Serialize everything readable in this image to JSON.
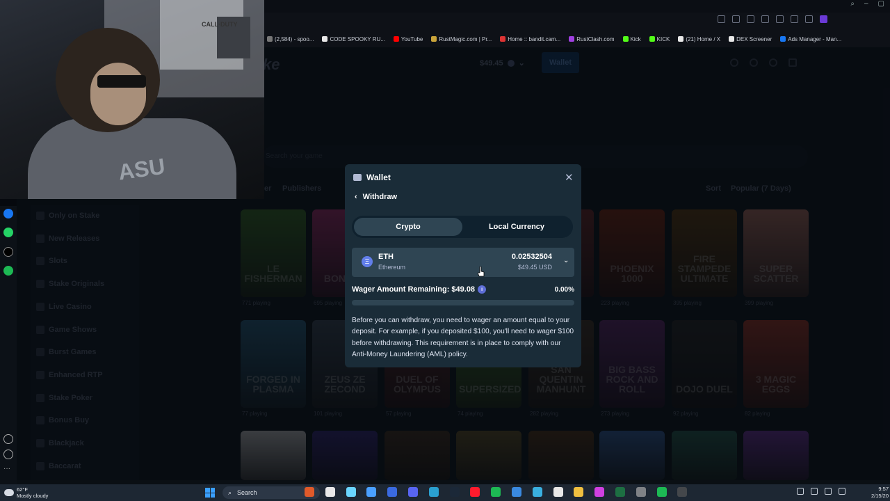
{
  "browser": {
    "bookmarks": [
      {
        "label": "(2,584) - spoo...",
        "color": "#777"
      },
      {
        "label": "CODE SPOOKY RU...",
        "color": "#e8e8e8"
      },
      {
        "label": "YouTube",
        "color": "#ff0000"
      },
      {
        "label": "RustMagic.com | Pr...",
        "color": "#c9a43a"
      },
      {
        "label": "Home :: bandit.cam...",
        "color": "#d33"
      },
      {
        "label": "RustClash.com",
        "color": "#a040e0"
      },
      {
        "label": "Kick",
        "color": "#53fc18"
      },
      {
        "label": "KICK",
        "color": "#53fc18"
      },
      {
        "label": "(21) Home / X",
        "color": "#e8e8e8"
      },
      {
        "label": "DEX Screener",
        "color": "#e8e8e8"
      },
      {
        "label": "Ads Manager - Man...",
        "color": "#1877f2"
      }
    ]
  },
  "webcam": {
    "shirt_text": "ASU",
    "poster_text": "CALL·DUTY"
  },
  "header": {
    "logo": "ke",
    "balance": "$49.45",
    "wallet_button": "Wallet",
    "search_placeholder": "Search your game"
  },
  "filters": {
    "label_left": "er",
    "publishers": "Publishers",
    "sort": "Sort",
    "sort_value": "Popular (7 Days)"
  },
  "sidebar": {
    "items": [
      "Only on Stake",
      "New Releases",
      "Slots",
      "Stake Originals",
      "Live Casino",
      "Game Shows",
      "Burst Games",
      "Enhanced RTP",
      "Stake Poker",
      "Bonus Buy",
      "Blackjack",
      "Baccarat"
    ]
  },
  "games": {
    "row1": [
      {
        "title": "LE FISHERMAN",
        "plays": "771 playing",
        "color": "#3f7a2a"
      },
      {
        "title": "BONA 10",
        "plays": "695 playing",
        "color": "#b8337a"
      },
      {
        "title": "",
        "plays": "",
        "color": "#2b2b2b"
      },
      {
        "title": "",
        "plays": "",
        "color": "#2b2b2b"
      },
      {
        "title": "",
        "plays": "",
        "color": "#7a2b2b"
      },
      {
        "title": "PHOENIX 1000",
        "plays": "223 playing",
        "color": "#8a2a12"
      },
      {
        "title": "FIRE STAMPEDE ULTIMATE",
        "plays": "395 playing",
        "color": "#6b4413"
      },
      {
        "title": "SUPER SCATTER",
        "plays": "399 playing",
        "color": "#c47b6b"
      }
    ],
    "row2": [
      {
        "title": "FORGED IN PLASMA",
        "plays": "77 playing",
        "color": "#2b6b8f"
      },
      {
        "title": "ZEUS ZE ZECOND",
        "plays": "101 playing",
        "color": "#3f4f60"
      },
      {
        "title": "DUEL OF OLYMPUS",
        "plays": "57 playing",
        "color": "#6b2a2a"
      },
      {
        "title": "SUPERSIZED",
        "plays": "74 playing",
        "color": "#4e8a2e"
      },
      {
        "title": "SAN QUENTIN MANHUNT",
        "plays": "282 playing",
        "color": "#4b3a2a"
      },
      {
        "title": "BIG BASS ROCK AND ROLL",
        "plays": "273 playing",
        "color": "#6b2d7a"
      },
      {
        "title": "DOJO DUEL",
        "plays": "92 playing",
        "color": "#2a2a2a"
      },
      {
        "title": "3 MAGIC EGGS",
        "plays": "82 playing",
        "color": "#b33a2a"
      }
    ],
    "row3": [
      {
        "color": "#d8d8d8"
      },
      {
        "color": "#3a2a8a"
      },
      {
        "color": "#4b3520"
      },
      {
        "color": "#6b5a2a"
      },
      {
        "color": "#5a3a1a"
      },
      {
        "color": "#3a6ab0"
      },
      {
        "color": "#2a6a5a"
      },
      {
        "color": "#7a3ab0"
      }
    ]
  },
  "modal": {
    "title": "Wallet",
    "close": "✕",
    "back_label": "Withdraw",
    "tabs": [
      "Crypto",
      "Local Currency"
    ],
    "active_tab": "Crypto",
    "coin": {
      "symbol": "ETH",
      "name": "Ethereum",
      "amount": "0.02532504",
      "usd": "$49.45 USD",
      "icon": "Ξ"
    },
    "wager_label": "Wager Amount Remaining: $49.08",
    "wager_percent": "0.00%",
    "wager_progress": 0,
    "note": "Before you can withdraw, you need to wager an amount equal to your deposit. For example, if you deposited $100, you'll need to wager $100 before withdrawing. This requirement is in place to comply with our Anti-Money Laundering (AML) policy."
  },
  "taskbar": {
    "weather_temp": "62°F",
    "weather_desc": "Mostly cloudy",
    "search": "Search",
    "time": "9:57",
    "date": "2/15/20"
  },
  "colors": {
    "accent": "#00e701",
    "modal_bg": "#1a2c38",
    "input_bg": "#2f4553",
    "page_bg": "#0d141b"
  }
}
